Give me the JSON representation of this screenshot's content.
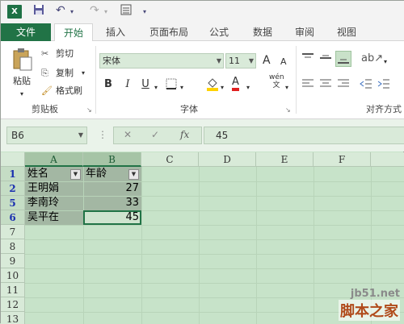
{
  "title_bar": {
    "app_icon": "X"
  },
  "ribbon_tabs": [
    {
      "label": "文件"
    },
    {
      "label": "开始"
    },
    {
      "label": "插入"
    },
    {
      "label": "页面布局"
    },
    {
      "label": "公式"
    },
    {
      "label": "数据"
    },
    {
      "label": "审阅"
    },
    {
      "label": "视图"
    }
  ],
  "clipboard": {
    "paste": "粘贴",
    "cut": "剪切",
    "copy": "复制",
    "format_painter": "格式刷",
    "group_label": "剪贴板"
  },
  "font": {
    "family": "宋体",
    "size": "11",
    "grow": "A",
    "shrink": "A",
    "bold": "B",
    "italic": "I",
    "underline": "U",
    "font_color": "A",
    "phonetic": "wén",
    "phonetic_sub": "文",
    "group_label": "字体"
  },
  "alignment": {
    "group_label": "对齐方式"
  },
  "formula_bar": {
    "name_box": "B6",
    "cancel": "✕",
    "enter": "✓",
    "fx": "fx",
    "value": "45"
  },
  "columns": [
    "A",
    "B",
    "C",
    "D",
    "E",
    "F"
  ],
  "rows": [
    "1",
    "2",
    "5",
    "6",
    "7",
    "8",
    "9",
    "10",
    "11",
    "12",
    "13"
  ],
  "cells": {
    "a1": "姓名",
    "b1": "年龄",
    "a2": "王明娟",
    "b2": "27",
    "a5": "李南玲",
    "b5": "33",
    "a6": "吴平在",
    "b6": "45"
  },
  "watermark": {
    "line1": "jb51.net",
    "line2": "脚本之家"
  }
}
